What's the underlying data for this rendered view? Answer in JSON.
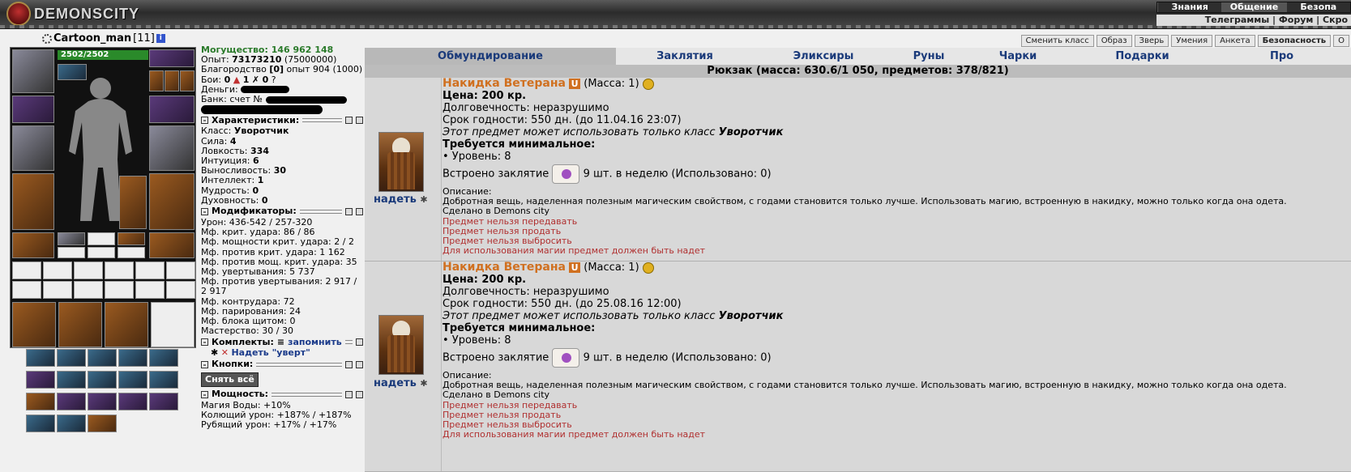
{
  "header": {
    "logo_text": "DEMONSCITY",
    "nav_row1": [
      "Знания",
      "Общение",
      "Безопа"
    ],
    "nav_row2": "Телеграммы | Форум | Скро"
  },
  "character": {
    "name": "Cartoon_man",
    "level": "[11]",
    "info_icon": "i",
    "hp": "2502/2502"
  },
  "action_buttons": [
    "Сменить класс",
    "Образ",
    "Зверь",
    "Умения",
    "Анкета",
    "Безопасность",
    "О"
  ],
  "stats": {
    "power_label": "Могущество:",
    "power_value": "146 962 148",
    "exp_label": "Опыт:",
    "exp_value": "73173210",
    "exp_next": "(75000000)",
    "valor_label": "Благородство",
    "valor_value": "[0]",
    "valor_exp": "опыт 904 (1000)",
    "fights_label": "Бои:",
    "fights": [
      "0",
      "1",
      "0"
    ],
    "money_label": "Деньги:",
    "bank_label": "Банк: счет №"
  },
  "characteristics": {
    "title": "Характеристики:",
    "rows": [
      {
        "label": "Класс:",
        "value": "Уворотчик"
      },
      {
        "label": "Сила:",
        "value": "4"
      },
      {
        "label": "Ловкость:",
        "value": "334"
      },
      {
        "label": "Интуиция:",
        "value": "6"
      },
      {
        "label": "Выносливость:",
        "value": "30"
      },
      {
        "label": "Интеллект:",
        "value": "1"
      },
      {
        "label": "Мудрость:",
        "value": "0"
      },
      {
        "label": "Духовность:",
        "value": "0"
      }
    ]
  },
  "modifiers": {
    "title": "Модификаторы:",
    "rows": [
      "Урон: 436-542 / 257-320",
      "Мф. крит. удара: 86 / 86",
      "Мф. мощности крит. удара: 2 / 2",
      "Мф. против крит. удара: 1 162",
      "Мф. против мощ. крит. удара: 35",
      "Мф. увертывания: 5 737",
      "Мф. против увертывания: 2 917 / 2 917",
      "Мф. контрудара: 72",
      "Мф. парирования: 24",
      "Мф. блока щитом: 0",
      "Мастерство: 30 / 30"
    ]
  },
  "sets": {
    "title": "Комплекты:",
    "remember": "запомнить",
    "item": "Надеть \"уверт\""
  },
  "buttons_section": {
    "title": "Кнопки:",
    "take_off_all": "Снять всё"
  },
  "power_section": {
    "title": "Мощность:",
    "rows": [
      "Магия Воды: +10%",
      "Колющий урон: +187% / +187%",
      "Рубящий урон: +17% / +17%"
    ]
  },
  "tabs": [
    "Обмундирование",
    "Заклятия",
    "Эликсиры",
    "Руны",
    "Чарки",
    "Подарки",
    "Про"
  ],
  "backpack_title": "Рюкзак (масса: 630.6/1 050, предметов: 378/821)",
  "items": [
    {
      "name": "Накидка Ветерана",
      "badge": "U",
      "mass": "(Масса: 1)",
      "price": "Цена: 200 кр.",
      "durability": "Долговечность: неразрушимо",
      "expiry": "Срок годности: 550 дн. (до 11.04.16 23:07)",
      "class_note_prefix": "Этот предмет может использовать только класс",
      "class_note_class": "Уворотчик",
      "req_title": "Требуется минимальное:",
      "req_level": "• Уровень: 8",
      "spell_prefix": "Встроено заклятие",
      "spell_suffix": "9 шт. в неделю (Использовано: 0)",
      "desc_label": "Описание:",
      "desc": "Добротная вещь, наделенная полезным магическим свойством, с годами становится только лучше. Использовать магию, встроенную в накидку, можно только когда она одета.",
      "made": "Сделано в Demons city",
      "restrictions": [
        "Предмет нельзя передавать",
        "Предмет нельзя продать",
        "Предмет нельзя выбросить",
        "Для использования магии предмет должен быть надет"
      ],
      "wear": "надеть"
    },
    {
      "name": "Накидка Ветерана",
      "badge": "U",
      "mass": "(Масса: 1)",
      "price": "Цена: 200 кр.",
      "durability": "Долговечность: неразрушимо",
      "expiry": "Срок годности: 550 дн. (до 25.08.16 12:00)",
      "class_note_prefix": "Этот предмет может использовать только класс",
      "class_note_class": "Уворотчик",
      "req_title": "Требуется минимальное:",
      "req_level": "• Уровень: 8",
      "spell_prefix": "Встроено заклятие",
      "spell_suffix": "9 шт. в неделю (Использовано: 0)",
      "desc_label": "Описание:",
      "desc": "Добротная вещь, наделенная полезным магическим свойством, с годами становится только лучше. Использовать магию, встроенную в накидку, можно только когда она одета.",
      "made": "Сделано в Demons city",
      "restrictions": [
        "Предмет нельзя передавать",
        "Предмет нельзя продать",
        "Предмет нельзя выбросить",
        "Для использования магии предмет должен быть надет"
      ],
      "wear": "надеть"
    }
  ]
}
